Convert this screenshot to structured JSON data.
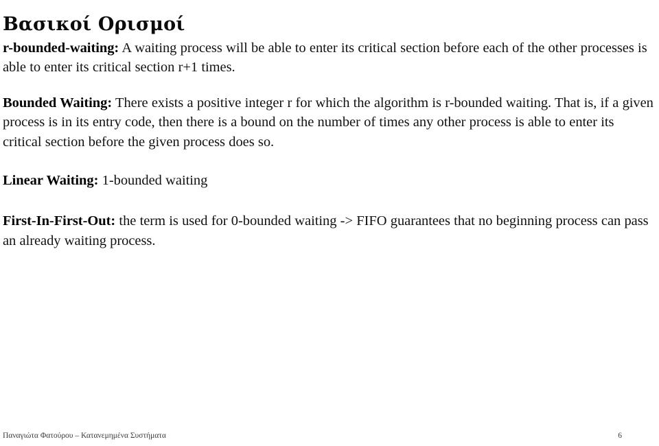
{
  "slide": {
    "title": "Βασικοί Ορισμοί",
    "background_color": "#ffffff",
    "text_color": "#111111",
    "definitions": [
      {
        "term": "r-bounded-waiting:",
        "text": " A waiting process will be able to enter its critical section before each of the other processes is able to enter its critical section r+1 times."
      },
      {
        "term": "Bounded Waiting:",
        "text": " There exists a positive integer r for which the algorithm is r-bounded waiting. That is, if a given process is in its entry code, then there is a bound on the number of times any other process is able to enter its critical section before the given process does so."
      },
      {
        "term": "Linear Waiting:",
        "text": " 1-bounded waiting"
      },
      {
        "term": "First-In-First-Out:",
        "text": " the term is used for 0-bounded waiting -> FIFO guarantees that no beginning process can pass an already waiting process."
      }
    ]
  },
  "footer": {
    "author_course": "Παναγιώτα Φατούρου – Κατανεμημένα Συστήματα",
    "page_number": "6"
  }
}
